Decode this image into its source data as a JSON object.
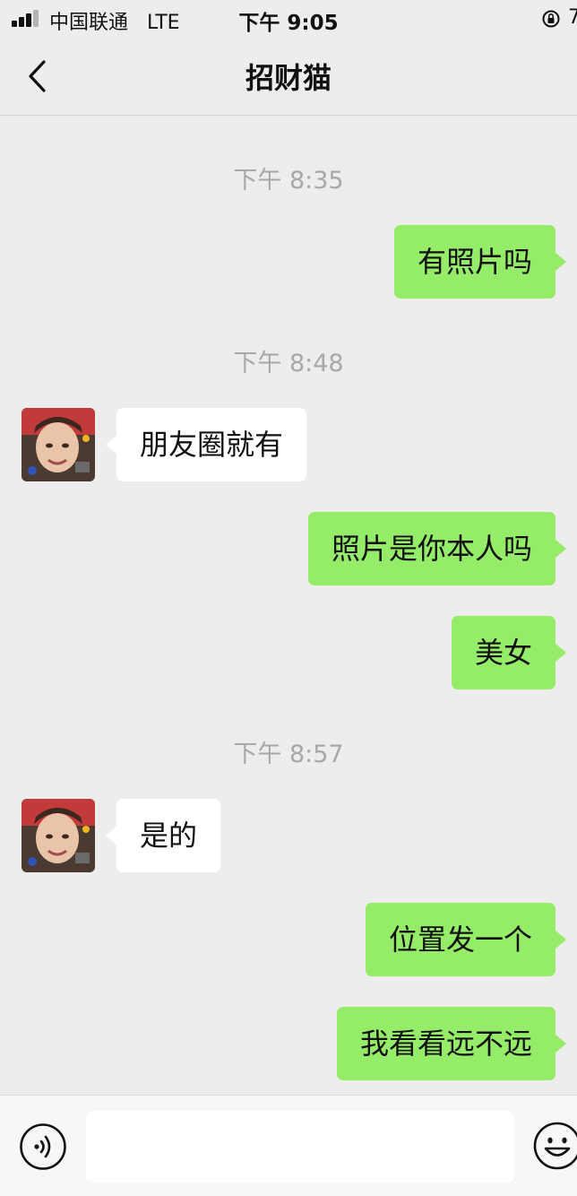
{
  "status_bar": {
    "carrier": "中国联通",
    "network": "LTE",
    "time": "下午 9:05",
    "battery_partial": "7"
  },
  "nav": {
    "title": "招财猫"
  },
  "messages": [
    {
      "type": "timestamp",
      "text": "下午 8:35"
    },
    {
      "type": "sent",
      "text": "有照片吗"
    },
    {
      "type": "timestamp",
      "text": "下午 8:48"
    },
    {
      "type": "received",
      "text": "朋友圈就有"
    },
    {
      "type": "sent",
      "text": "照片是你本人吗"
    },
    {
      "type": "sent",
      "text": "美女"
    },
    {
      "type": "timestamp",
      "text": "下午 8:57"
    },
    {
      "type": "received",
      "text": "是的"
    },
    {
      "type": "sent",
      "text": "位置发一个"
    },
    {
      "type": "sent",
      "text": "我看看远不远"
    }
  ],
  "input_bar": {
    "text_value": "",
    "voice_icon": "voice-icon",
    "emoji_icon": "emoji-icon"
  },
  "colors": {
    "background": "#ededed",
    "sent_bubble": "#95ec69",
    "received_bubble": "#ffffff",
    "timestamp": "#a8a8a8"
  }
}
